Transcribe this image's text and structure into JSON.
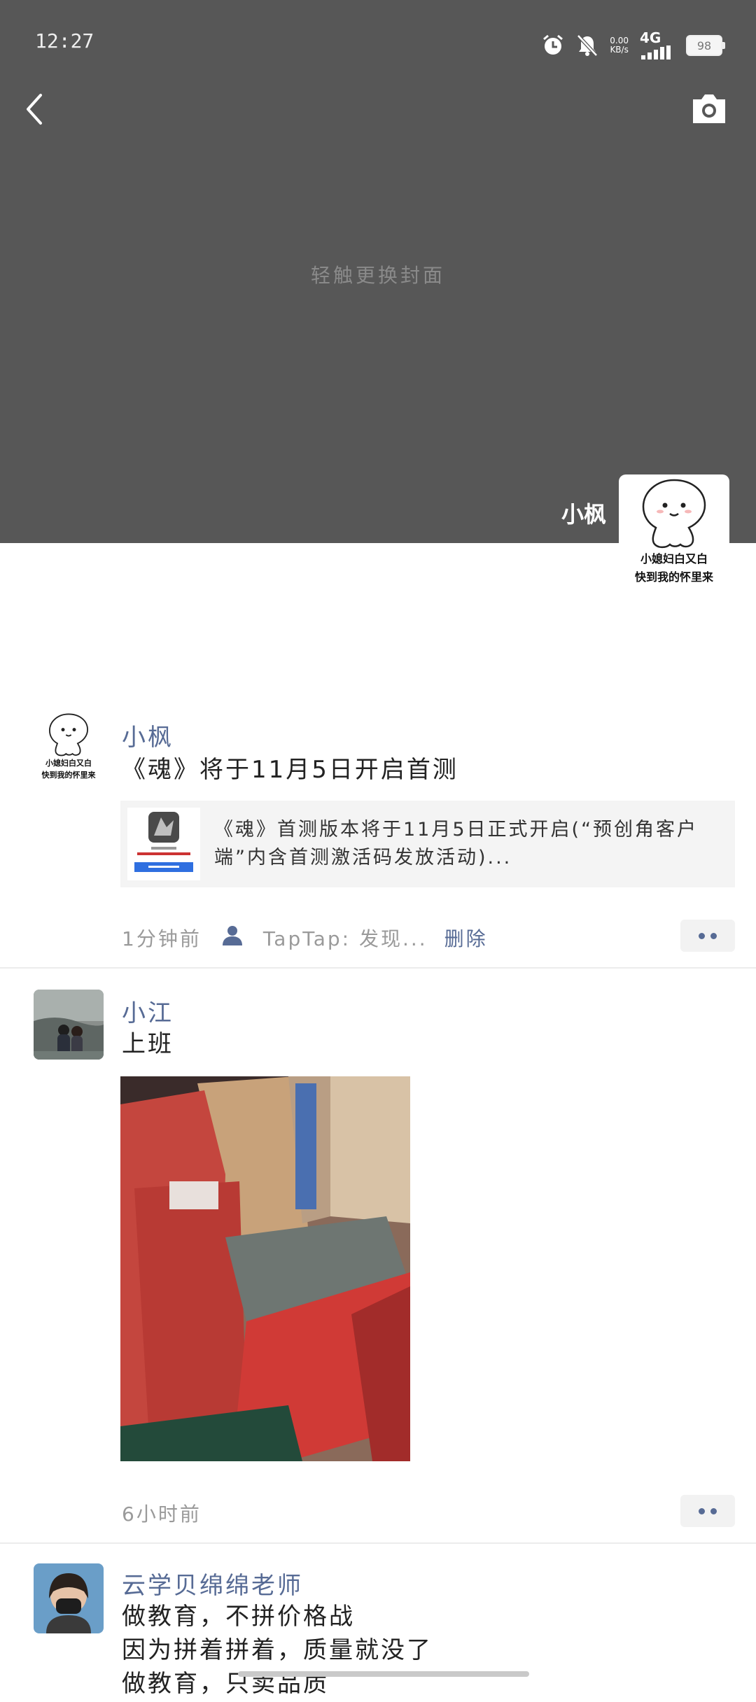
{
  "status_bar": {
    "time": "12:27",
    "net_speed_value": "0.00",
    "net_speed_unit": "KB/s",
    "network": "4G",
    "battery": "98"
  },
  "header": {
    "back_icon": "chevron-left-icon",
    "camera_icon": "camera-icon"
  },
  "cover": {
    "hint": "轻触更换封面",
    "user_name": "小枫",
    "avatar_caption_line1": "小媳妇白又白",
    "avatar_caption_line2": "快到我的怀里来"
  },
  "posts": [
    {
      "nickname": "小枫",
      "text": "《魂》将于11月5日开启首测",
      "avatar_caption_line1": "小媳妇白又白",
      "avatar_caption_line2": "快到我的怀里来",
      "link": {
        "title": "《魂》首测版本将于11月5日正式开启(“预创角客户端”内含首测激活码发放活动)..."
      },
      "time": "1分钟前",
      "source": "TapTap: 发现...",
      "delete_label": "删除"
    },
    {
      "nickname": "小江",
      "text": "上班",
      "time": "6小时前"
    },
    {
      "nickname": "云学贝绵绵老师",
      "lines": [
        "做教育，不拼价格战",
        "因为拼着拼着，质量就没了",
        "做教育，只卖品质"
      ]
    }
  ],
  "colors": {
    "cover_bg": "#575757",
    "nickname": "#576b95",
    "text": "#222222",
    "meta": "#9a9a9a"
  }
}
